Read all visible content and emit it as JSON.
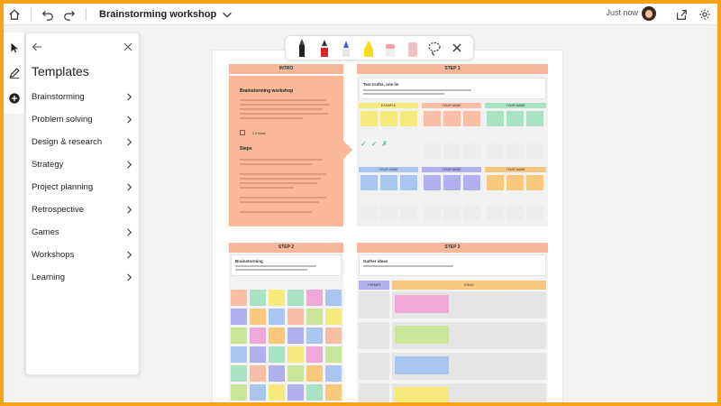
{
  "header": {
    "title": "Brainstorming workshop",
    "status": "Just now"
  },
  "panel": {
    "title": "Templates",
    "items": [
      {
        "label": "Brainstorming"
      },
      {
        "label": "Problem solving"
      },
      {
        "label": "Design & research"
      },
      {
        "label": "Strategy"
      },
      {
        "label": "Project planning"
      },
      {
        "label": "Retrospective"
      },
      {
        "label": "Games"
      },
      {
        "label": "Workshops"
      },
      {
        "label": "Learning"
      }
    ]
  },
  "board": {
    "intro_header": "INTRO",
    "intro_title": "Brainstorming workshop",
    "intro_time": "1-2 hours",
    "intro_steps": "Steps",
    "step1_header": "STEP 1",
    "step1_card_title": "Two truths, one lie",
    "step1_example": "EXAMPLE",
    "step1_your_name": "YOUR NAME",
    "step2_header": "STEP 2",
    "step2_card_title": "Brainstorming",
    "step3_header": "STEP 3",
    "step3_card_title": "Gather ideas",
    "step3_themes": "THEMES",
    "step3_ideas": "IDEAS"
  },
  "colors": {
    "frame": "#f7a21b",
    "header_bg": "#f7b79a",
    "intro_bg": "#f9b998",
    "yellow": "#f6ea7c",
    "peach": "#f9bfa6",
    "green": "#a9e3c3",
    "blue": "#a9c6f1",
    "purple": "#b1b0ee",
    "orange": "#f8c87c",
    "pink": "#f0a8d8",
    "lime": "#c9e59a"
  },
  "icons": {
    "home": "home-icon",
    "undo": "undo-icon",
    "redo": "redo-icon",
    "chevron": "chevron-down-icon",
    "share": "share-icon",
    "settings": "gear-icon",
    "select": "pointer-icon",
    "pen": "pen-icon",
    "add": "plus-circle-icon",
    "lasso": "lasso-icon",
    "close": "close-icon"
  }
}
